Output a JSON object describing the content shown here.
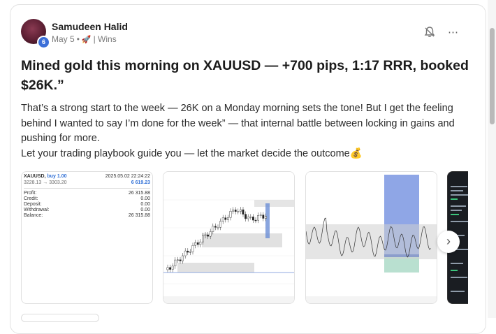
{
  "post": {
    "author": "Samudeen Halid",
    "badge": "6",
    "date": "May 5",
    "separator": "•",
    "rocket_icon": "🚀",
    "category": "| Wins",
    "title": "Mined gold this morning on XAUUSD — +700 pips, 1:17 RRR, booked $26K.”",
    "body": [
      "That’s a strong start to the week — 26K on a Monday morning sets the tone! But I get the feeling behind I wanted to say I’m done for the week” — that internal battle between locking in gains and pushing for more.",
      "Let your trading playbook guide you — let the market decide the outcome💰"
    ]
  },
  "actions": {
    "bell_icon": "bell-off-icon",
    "more_icon": "⋯",
    "next_icon": "›"
  },
  "account_snapshot": {
    "symbol": "XAUUSD,",
    "direction": "buy 1.00",
    "timestamp": "2025.05.02 22:24:22",
    "prices": "3228.13 → 3303.20",
    "profit_value": "6 619.23",
    "rows": [
      {
        "label": "Profit:",
        "value": "26 315.88"
      },
      {
        "label": "Credit:",
        "value": "0.00"
      },
      {
        "label": "Deposit:",
        "value": "0.00"
      },
      {
        "label": "Withdrawal:",
        "value": "0.00"
      },
      {
        "label": "Balance:",
        "value": "26 315.88"
      }
    ]
  }
}
